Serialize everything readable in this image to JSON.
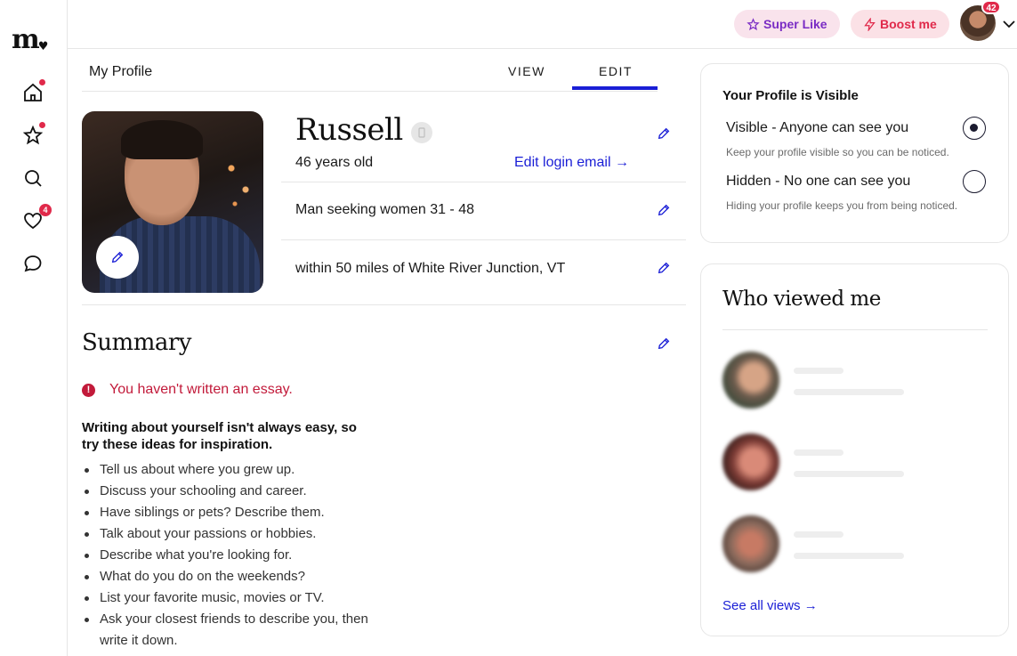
{
  "app": {
    "logo_text": "m",
    "logo_heart": "♥"
  },
  "nav": {
    "items": [
      {
        "name": "home",
        "icon": "home-icon",
        "has_dot": true
      },
      {
        "name": "likes",
        "icon": "star-icon",
        "has_dot": true
      },
      {
        "name": "search",
        "icon": "search-icon",
        "has_dot": false
      },
      {
        "name": "matches",
        "icon": "heart-icon",
        "badge": "4"
      },
      {
        "name": "messages",
        "icon": "chat-bubble-icon",
        "has_dot": false
      }
    ]
  },
  "topbar": {
    "super_like_label": "Super Like",
    "boost_label": "Boost me",
    "notifications_count": "42"
  },
  "profile": {
    "section_label": "My Profile",
    "tabs": {
      "view": "VIEW",
      "edit": "EDIT",
      "active": "EDIT"
    },
    "name": "Russell",
    "age": "46 years old",
    "edit_login_email": "Edit login email →",
    "seeking": "Man seeking women 31 - 48",
    "location": "within 50 miles of White River Junction, VT"
  },
  "summary": {
    "title": "Summary",
    "warning": "You haven't written an essay.",
    "tips_title": "Writing about yourself isn't always easy, so try these ideas for inspiration.",
    "tips": [
      "Tell us about where you grew up.",
      "Discuss your schooling and career.",
      "Have siblings or pets? Describe them.",
      "Talk about your passions or hobbies.",
      "Describe what you're looking for.",
      "What do you do on the weekends?",
      "List your favorite music, movies or TV.",
      "Ask your closest friends to describe you, then write it down."
    ]
  },
  "visibility": {
    "title": "Your Profile is Visible",
    "visible_label": "Visible - Anyone can see you",
    "visible_sub": "Keep your profile visible so you can be noticed.",
    "hidden_label": "Hidden - No one can see you",
    "hidden_sub": "Hiding your profile keeps you from being noticed.",
    "selected": "visible"
  },
  "viewers": {
    "title": "Who viewed me",
    "see_all": "See all views →",
    "items": [
      {
        "avatar_color": "#6b5a4c"
      },
      {
        "avatar_color": "#7a3a34"
      },
      {
        "avatar_color": "#8a6a5c"
      }
    ]
  },
  "colors": {
    "accent_blue": "#1a1ed6",
    "alert_red": "#c21a3a",
    "badge_red": "#e0294a",
    "super_like_purple": "#7a2cc4"
  }
}
